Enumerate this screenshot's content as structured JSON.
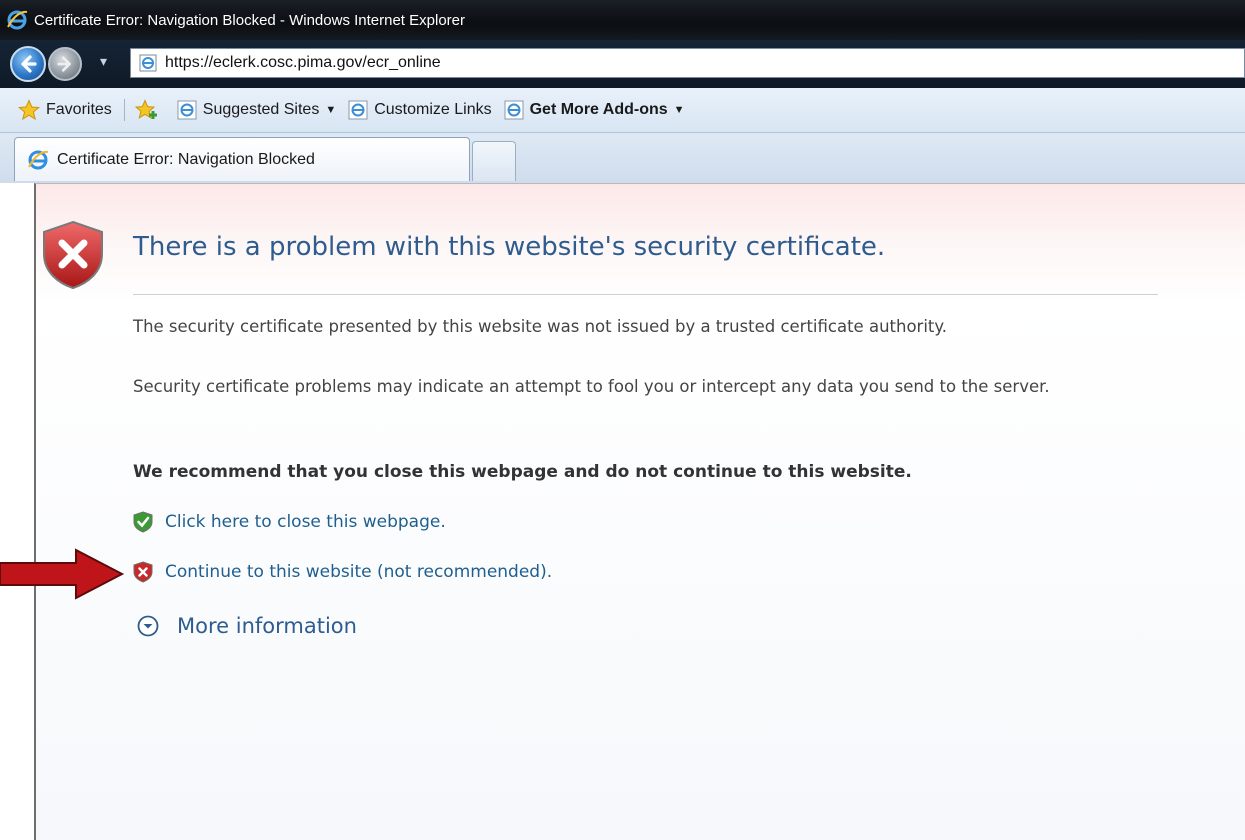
{
  "window": {
    "title": "Certificate Error: Navigation Blocked - Windows Internet Explorer"
  },
  "nav": {
    "address": "https://eclerk.cosc.pima.gov/ecr_online"
  },
  "favorites_bar": {
    "favorites_label": "Favorites",
    "items": [
      {
        "label": "Suggested Sites",
        "has_dropdown": true
      },
      {
        "label": "Customize Links",
        "has_dropdown": false
      },
      {
        "label": "Get More Add-ons",
        "has_dropdown": true,
        "bold": true
      }
    ]
  },
  "tabs": [
    {
      "label": "Certificate Error: Navigation Blocked",
      "active": true
    }
  ],
  "content": {
    "headline": "There is a problem with this website's security certificate.",
    "paragraph_1": "The security certificate presented by this website was not issued by a trusted certificate authority.",
    "paragraph_2": "Security certificate problems may indicate an attempt to fool you or intercept any data you send to the server.",
    "recommendation": "We recommend that you close this webpage and do not continue to this website.",
    "close_link": "Click here to close this webpage.",
    "continue_link": "Continue to this website (not recommended).",
    "more_info": "More information"
  },
  "colors": {
    "headline": "#2e5c8e",
    "link": "#1f5f8f",
    "arrow": "#c0141b",
    "shield_red": "#c62a2a",
    "shield_green": "#3c9a35"
  },
  "icons": {
    "window": "ie-logo-icon",
    "back": "back-arrow-icon",
    "forward": "forward-arrow-icon",
    "favorites": "star-icon",
    "add_favorites": "add-favorites-icon",
    "warning": "red-shield-x-icon",
    "safe": "green-shield-check-icon",
    "expand": "chevron-down-circle-icon",
    "annotation": "red-arrow-icon"
  }
}
